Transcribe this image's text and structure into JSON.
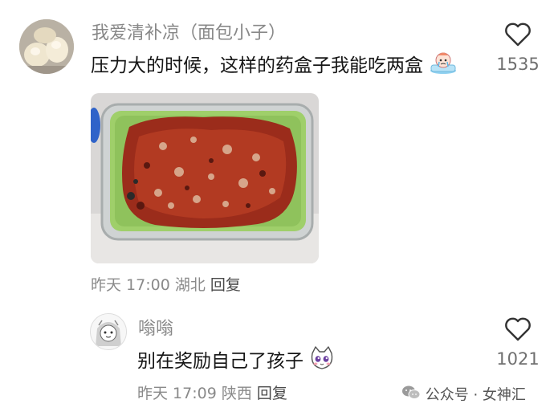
{
  "comments": [
    {
      "username": "我爱清补凉（面包小子）",
      "text": "压力大的时候，这样的药盒子我能吃两盒",
      "likes": "1535",
      "date": "昨天 17:00",
      "location": "湖北",
      "reply_label": "回复"
    },
    {
      "username": "嗡嗡",
      "text": "别在奖励自己了孩子",
      "likes": "1021",
      "date": "昨天 17:09",
      "location": "陕西",
      "reply_label": "回复"
    }
  ],
  "watermark": {
    "text": "公众号 · 女神汇",
    "icon": "wechat-icon"
  },
  "icons": {
    "like": "heart-outline-icon",
    "emoji_1": "crying-face-sticker",
    "emoji_2": "cat-face-sticker"
  }
}
